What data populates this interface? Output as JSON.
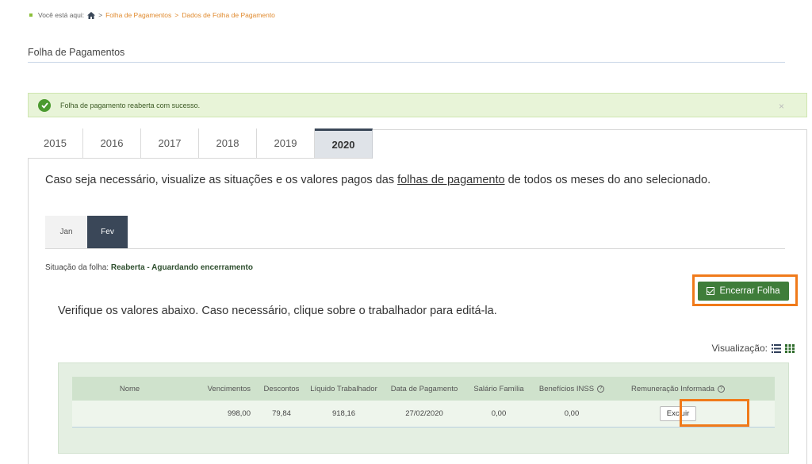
{
  "breadcrumb": {
    "prefix": "Você está aqui:",
    "items": [
      "Folha de Pagamentos",
      "Dados de Folha de Pagamento"
    ],
    "separator": ">"
  },
  "page": {
    "title": "Folha de Pagamentos"
  },
  "alert": {
    "message": "Folha de pagamento reaberta com sucesso.",
    "close": "×"
  },
  "year_tabs": [
    {
      "label": "2015"
    },
    {
      "label": "2016"
    },
    {
      "label": "2017"
    },
    {
      "label": "2018"
    },
    {
      "label": "2019"
    },
    {
      "label": "2020",
      "active": true
    }
  ],
  "intro": {
    "before": "Caso seja necessário, visualize as situações e os valores pagos das ",
    "link": "folhas de pagamento",
    "after": " de todos os meses do ano selecionado."
  },
  "month_tabs": [
    {
      "label": "Jan"
    },
    {
      "label": "Fev",
      "active": true
    }
  ],
  "status": {
    "label": "Situação da folha:",
    "value": "Reaberta - Aguardando encerramento"
  },
  "close_button": {
    "label": "Encerrar Folha"
  },
  "verify_text": "Verifique os valores abaixo. Caso necessário, clique sobre o trabalhador para editá-la.",
  "visualization": {
    "label": "Visualização:",
    "icons": [
      "list-icon",
      "grid-icon"
    ]
  },
  "table": {
    "headers": [
      "Nome",
      "Vencimentos",
      "Descontos",
      "Líquido Trabalhador",
      "Data de Pagamento",
      "Salário Família",
      "Benefícios INSS",
      "Remuneração Informada"
    ],
    "rows": [
      {
        "nome": "",
        "vencimentos": "998,00",
        "descontos": "79,84",
        "liquido": "918,16",
        "data": "27/02/2020",
        "salario_familia": "0,00",
        "beneficios_inss": "0,00",
        "action": "Excluir"
      }
    ]
  },
  "colors": {
    "accent_green": "#3f7d3a",
    "highlight_orange": "#f07a1a",
    "tab_dark": "#3a4758",
    "alert_bg": "#e8f4d8"
  }
}
